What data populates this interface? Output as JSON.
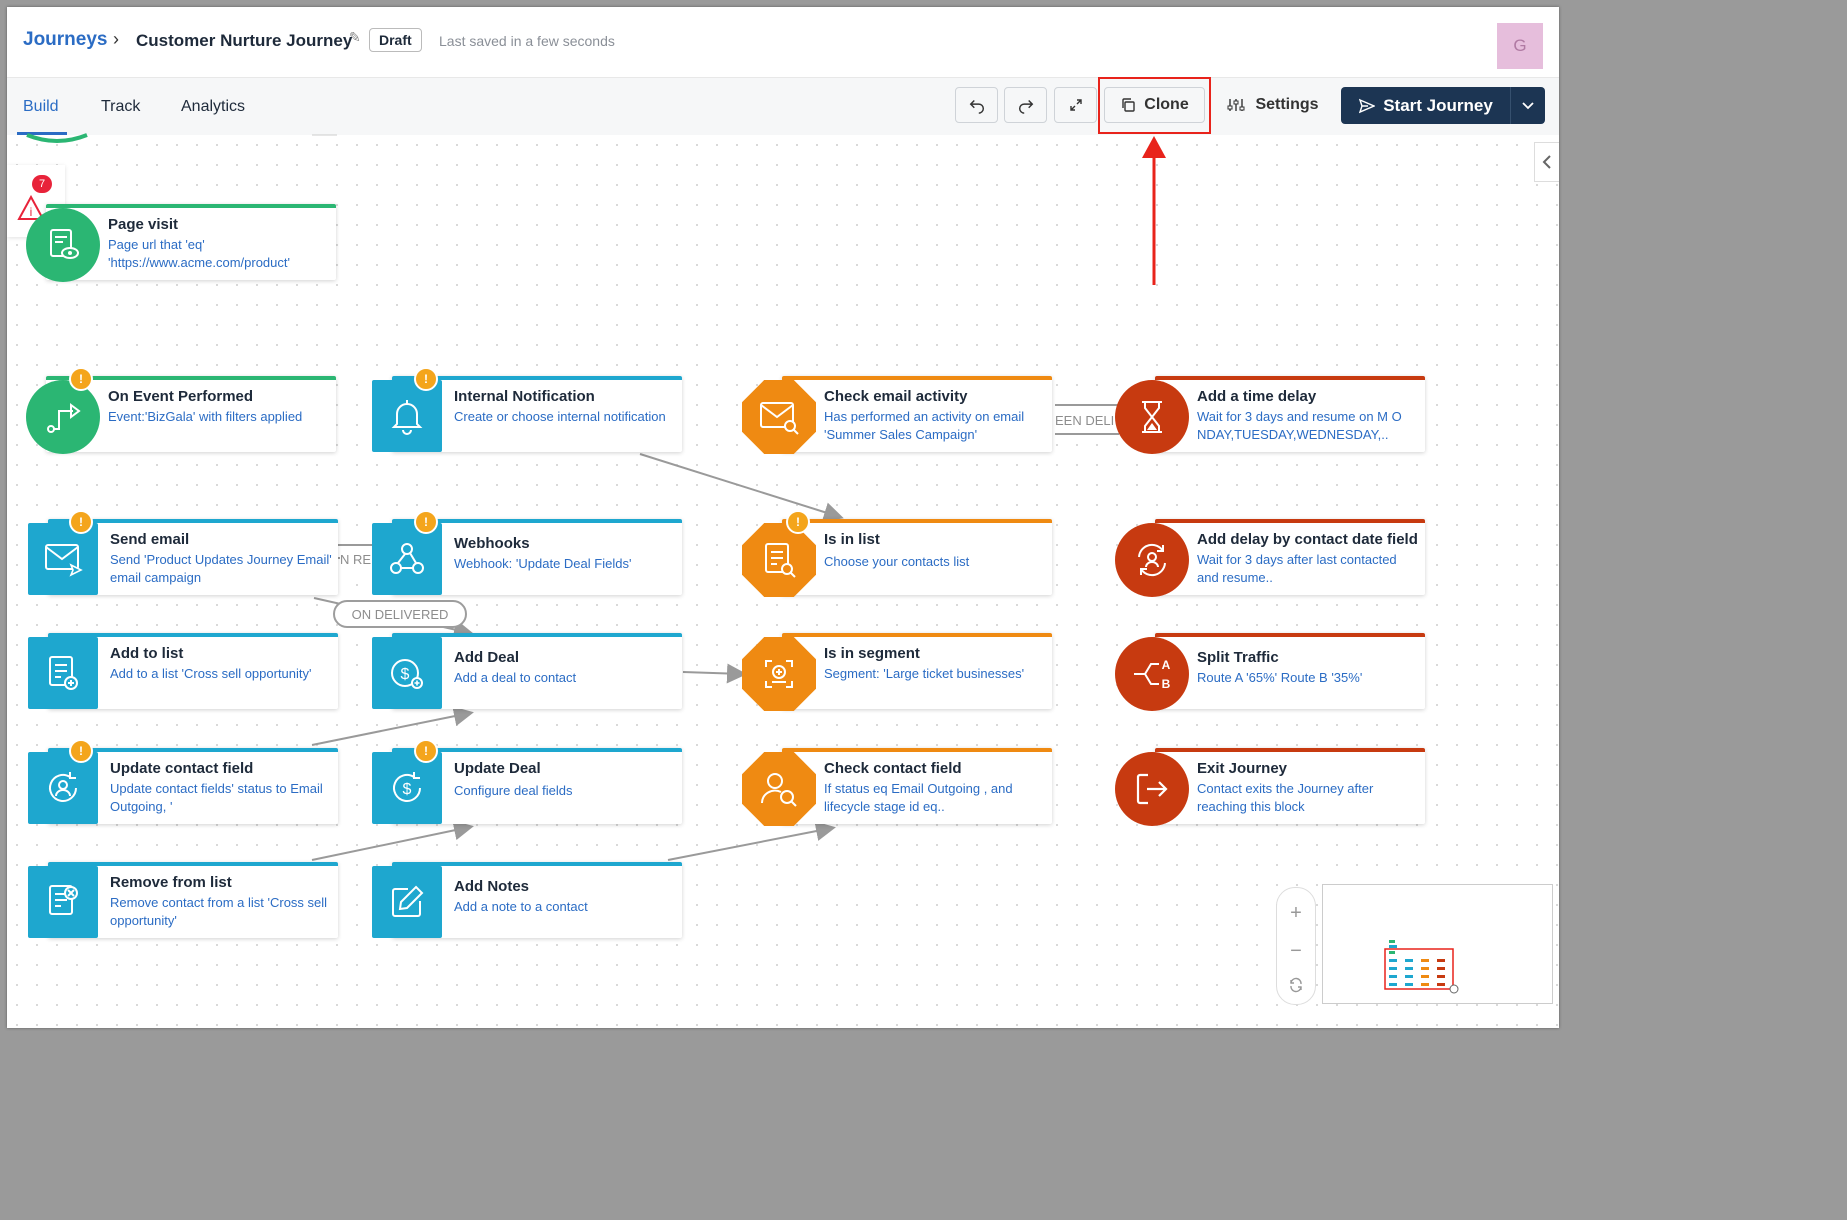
{
  "header": {
    "breadcrumb_root": "Journeys",
    "breadcrumb_sep": "›",
    "journey_name": "Customer Nurture Journey",
    "status_badge": "Draft",
    "saved_text": "Last saved in a few seconds",
    "avatar_initial": "G"
  },
  "tabs": {
    "build": "Build",
    "track": "Track",
    "analytics": "Analytics"
  },
  "toolbar": {
    "clone_label": "Clone",
    "settings_label": "Settings",
    "start_label": "Start Journey"
  },
  "alerts": {
    "count": "7"
  },
  "edge_labels": {
    "delivered_pill": "ON DELIVERED",
    "open_rep": "N REP",
    "been_deli": "EEN DELI"
  },
  "colors": {
    "green": "#2bb673",
    "blue": "#1ea7cf",
    "orange": "#ef8a12",
    "red": "#c73a10",
    "warning": "#f4a51c",
    "highlight": "#e8231b"
  },
  "nodes": {
    "page_visit": {
      "title": "Page visit",
      "desc": "Page url that 'eq' 'https://www.acme.com/product'"
    },
    "on_event": {
      "title": "On Event Performed",
      "desc": "Event:'BizGala' with filters applied"
    },
    "send_email": {
      "title": "Send email",
      "desc": "Send 'Product Updates Journey Email' email campaign"
    },
    "add_to_list": {
      "title": "Add to list",
      "desc": "Add to a list 'Cross sell opportunity'"
    },
    "update_contact": {
      "title": "Update contact field",
      "desc": "Update contact fields' status to Email Outgoing, '"
    },
    "remove_from_list": {
      "title": "Remove from list",
      "desc": "Remove contact from a list 'Cross sell opportunity'"
    },
    "internal_notification": {
      "title": "Internal Notification",
      "desc": "Create or choose internal notification"
    },
    "webhooks": {
      "title": "Webhooks",
      "desc": "Webhook: 'Update Deal Fields'"
    },
    "add_deal": {
      "title": "Add Deal",
      "desc": "Add a deal to contact"
    },
    "update_deal": {
      "title": "Update Deal",
      "desc": "Configure deal fields"
    },
    "add_notes": {
      "title": "Add Notes",
      "desc": "Add a note to a contact"
    },
    "check_email": {
      "title": "Check email activity",
      "desc": "Has performed an activity on email 'Summer Sales Campaign'"
    },
    "is_in_list": {
      "title": "Is in list",
      "desc": "Choose your contacts list"
    },
    "is_in_segment": {
      "title": "Is in segment",
      "desc": "Segment: 'Large ticket businesses'"
    },
    "check_contact": {
      "title": "Check contact field",
      "desc": "If status eq Email Outgoing , and lifecycle stage id eq.."
    },
    "time_delay": {
      "title": "Add a time delay",
      "desc": "Wait for 3 days and resume on M ONDAY,TUESDAY,WEDNESDAY,.."
    },
    "delay_contact_date": {
      "title": "Add delay by contact date field",
      "desc": "Wait for 3 days after last contacted and resume.."
    },
    "split_traffic": {
      "title": "Split Traffic",
      "desc": "Route A '65%' Route B '35%'"
    },
    "exit_journey": {
      "title": "Exit Journey",
      "desc": "Contact exits the Journey after reaching this block"
    }
  },
  "minimap": {
    "zoom_in": "+",
    "zoom_out": "−"
  }
}
